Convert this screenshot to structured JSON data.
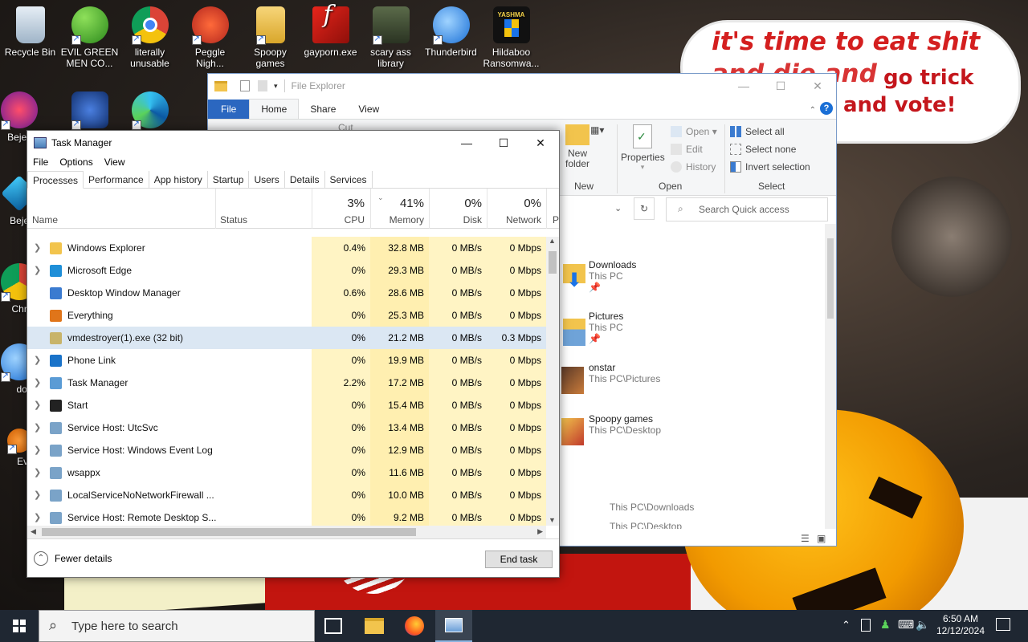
{
  "desktop": {
    "icons_row1": [
      "Recycle Bin",
      "EVIL GREEN MEN CO...",
      "literally unusable",
      "Peggle Nigh...",
      "Spoopy games",
      "gayporn.exe",
      "scary ass library",
      "Thunderbird",
      "Hildaboo Ransomwa..."
    ],
    "partial_labels": [
      "Bejev De",
      "Beje De",
      "Chr De",
      "does",
      "Ever"
    ],
    "wallpaper_text_1": "it's time to eat shit",
    "wallpaper_text_2": "and die and",
    "wallpaper_text_3": "go trick",
    "wallpaper_text_4": "and vote!"
  },
  "file_explorer": {
    "title": "File Explorer",
    "tabs": [
      "File",
      "Home",
      "Share",
      "View"
    ],
    "ribbon": {
      "cut": "Cut",
      "new_folder": "New folder",
      "properties": "Properties",
      "open": "Open",
      "edit": "Edit",
      "history": "History",
      "select_all": "Select all",
      "select_none": "Select none",
      "invert_selection": "Invert selection",
      "group_new": "New",
      "group_open": "Open",
      "group_select": "Select"
    },
    "search_placeholder": "Search Quick access",
    "items": [
      {
        "name": "Downloads",
        "sub": "This PC"
      },
      {
        "name": "Pictures",
        "sub": "This PC"
      },
      {
        "name": "onstar",
        "sub": "This PC\\Pictures"
      },
      {
        "name": "Spoopy games",
        "sub": "This PC\\Desktop"
      }
    ],
    "recent_paths": [
      "This PC\\Downloads",
      "This PC\\Desktop"
    ]
  },
  "task_manager": {
    "title": "Task Manager",
    "menu": [
      "File",
      "Options",
      "View"
    ],
    "tabs": [
      "Processes",
      "Performance",
      "App history",
      "Startup",
      "Users",
      "Details",
      "Services"
    ],
    "columns": {
      "name": "Name",
      "status": "Status",
      "cpu": "CPU",
      "memory": "Memory",
      "disk": "Disk",
      "network": "Network",
      "power": "P",
      "cpu_pct": "3%",
      "memory_pct": "41%",
      "disk_pct": "0%",
      "network_pct": "0%"
    },
    "processes": [
      {
        "name": "Windows Explorer",
        "cpu": "0.4%",
        "memory": "32.8 MB",
        "disk": "0 MB/s",
        "network": "0 Mbps",
        "expand": true,
        "icon": "folder",
        "color": "#f2c44d"
      },
      {
        "name": "Microsoft Edge",
        "cpu": "0%",
        "memory": "29.3 MB",
        "disk": "0 MB/s",
        "network": "0 Mbps",
        "expand": true,
        "icon": "edge",
        "color": "#1f8fd8"
      },
      {
        "name": "Desktop Window Manager",
        "cpu": "0.6%",
        "memory": "28.6 MB",
        "disk": "0 MB/s",
        "network": "0 Mbps",
        "expand": false,
        "icon": "window",
        "color": "#3b7bd0"
      },
      {
        "name": "Everything",
        "cpu": "0%",
        "memory": "25.3 MB",
        "disk": "0 MB/s",
        "network": "0 Mbps",
        "expand": false,
        "icon": "magnifier",
        "color": "#e0751a"
      },
      {
        "name": "vmdestroyer(1).exe (32 bit)",
        "cpu": "0%",
        "memory": "21.2 MB",
        "disk": "0 MB/s",
        "network": "0.3 Mbps",
        "expand": false,
        "icon": "exe",
        "color": "#c8b46a",
        "selected": true
      },
      {
        "name": "Phone Link",
        "cpu": "0%",
        "memory": "19.9 MB",
        "disk": "0 MB/s",
        "network": "0 Mbps",
        "expand": true,
        "icon": "phone",
        "color": "#1a73c9"
      },
      {
        "name": "Task Manager",
        "cpu": "2.2%",
        "memory": "17.2 MB",
        "disk": "0 MB/s",
        "network": "0 Mbps",
        "expand": true,
        "icon": "taskmgr",
        "color": "#5a9bd5"
      },
      {
        "name": "Start",
        "cpu": "0%",
        "memory": "15.4 MB",
        "disk": "0 MB/s",
        "network": "0 Mbps",
        "expand": true,
        "icon": "start",
        "color": "#222222"
      },
      {
        "name": "Service Host: UtcSvc",
        "cpu": "0%",
        "memory": "13.4 MB",
        "disk": "0 MB/s",
        "network": "0 Mbps",
        "expand": true,
        "icon": "gear",
        "color": "#7aa3c8"
      },
      {
        "name": "Service Host: Windows Event Log",
        "cpu": "0%",
        "memory": "12.9 MB",
        "disk": "0 MB/s",
        "network": "0 Mbps",
        "expand": true,
        "icon": "gear",
        "color": "#7aa3c8"
      },
      {
        "name": "wsappx",
        "cpu": "0%",
        "memory": "11.6 MB",
        "disk": "0 MB/s",
        "network": "0 Mbps",
        "expand": true,
        "icon": "gear",
        "color": "#7aa3c8"
      },
      {
        "name": "LocalServiceNoNetworkFirewall ...",
        "cpu": "0%",
        "memory": "10.0 MB",
        "disk": "0 MB/s",
        "network": "0 Mbps",
        "expand": true,
        "icon": "gear",
        "color": "#7aa3c8"
      },
      {
        "name": "Service Host: Remote Desktop S...",
        "cpu": "0%",
        "memory": "9.2 MB",
        "disk": "0 MB/s",
        "network": "0 Mbps",
        "expand": true,
        "icon": "gear",
        "color": "#7aa3c8"
      }
    ],
    "fewer_details": "Fewer details",
    "end_task": "End task"
  },
  "taskbar": {
    "search_placeholder": "Type here to search",
    "time": "6:50 AM",
    "date": "12/12/2024"
  }
}
